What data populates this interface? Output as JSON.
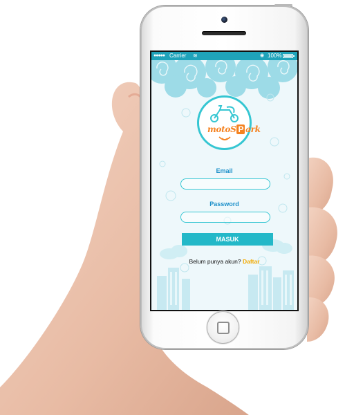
{
  "status_bar": {
    "signal": "●●●●●",
    "carrier": "Carrier",
    "time": "",
    "battery_percent": "100%"
  },
  "app": {
    "logo_text_prefix": "moto",
    "logo_letter_s": "S",
    "logo_letter_p": "P",
    "logo_text_suffix": "ark"
  },
  "login_form": {
    "email_label": "Email",
    "email_value": "",
    "password_label": "Password",
    "password_value": "",
    "submit_label": "MASUK"
  },
  "signup": {
    "prompt": "Belum punya akun? ",
    "link_label": "Daftar"
  },
  "colors": {
    "accent": "#23b8c8",
    "status_bar": "#1fa3ba",
    "label": "#1b8fc9",
    "logo": "#f58220",
    "link": "#f2a900"
  }
}
